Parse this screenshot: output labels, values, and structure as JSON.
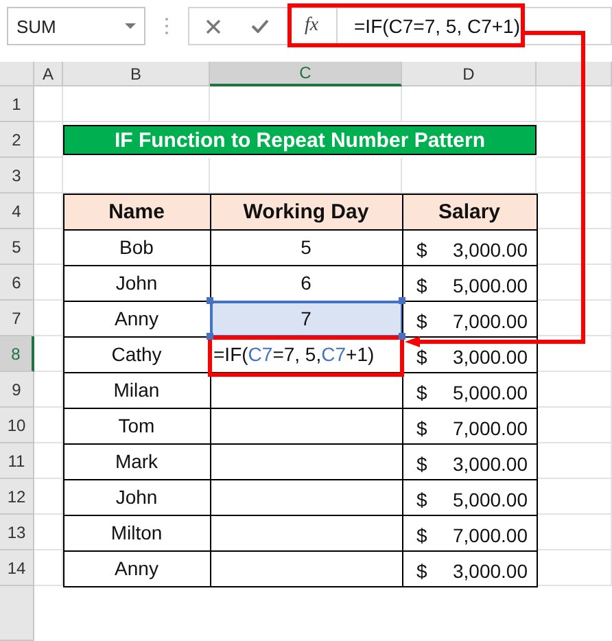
{
  "formula_bar": {
    "name_box": "SUM",
    "fx": "fx",
    "formula": "=IF(C7=7, 5, C7+1)"
  },
  "column_headers": [
    {
      "label": "A",
      "selected": false
    },
    {
      "label": "B",
      "selected": false
    },
    {
      "label": "C",
      "selected": true
    },
    {
      "label": "D",
      "selected": false
    }
  ],
  "row_headers": [
    {
      "label": "1",
      "selected": false
    },
    {
      "label": "2",
      "selected": false
    },
    {
      "label": "3",
      "selected": false
    },
    {
      "label": "4",
      "selected": false
    },
    {
      "label": "5",
      "selected": false
    },
    {
      "label": "6",
      "selected": false
    },
    {
      "label": "7",
      "selected": false
    },
    {
      "label": "8",
      "selected": true
    },
    {
      "label": "9",
      "selected": false
    },
    {
      "label": "10",
      "selected": false
    },
    {
      "label": "11",
      "selected": false
    },
    {
      "label": "12",
      "selected": false
    },
    {
      "label": "13",
      "selected": false
    },
    {
      "label": "14",
      "selected": false
    }
  ],
  "title": "IF Function to Repeat Number Pattern",
  "table": {
    "columns": [
      "Name",
      "Working Day",
      "Salary"
    ],
    "rows": [
      {
        "name": "Bob",
        "working_day": "5",
        "currency": "$",
        "salary": "3,000.00",
        "referenced": false,
        "editing": false
      },
      {
        "name": "John",
        "working_day": "6",
        "currency": "$",
        "salary": "5,000.00",
        "referenced": false,
        "editing": false
      },
      {
        "name": "Anny",
        "working_day": "7",
        "currency": "$",
        "salary": "7,000.00",
        "referenced": true,
        "editing": false
      },
      {
        "name": "Cathy",
        "formula_parts": [
          {
            "text": "=IF(",
            "ref": false
          },
          {
            "text": "C7",
            "ref": true
          },
          {
            "text": "=7, 5, ",
            "ref": false
          },
          {
            "text": "C7",
            "ref": true
          },
          {
            "text": "+1)",
            "ref": false
          }
        ],
        "currency": "$",
        "salary": "3,000.00",
        "referenced": false,
        "editing": true
      },
      {
        "name": "Milan",
        "currency": "$",
        "salary": "5,000.00",
        "referenced": false,
        "editing": false
      },
      {
        "name": "Tom",
        "currency": "$",
        "salary": "7,000.00",
        "referenced": false,
        "editing": false
      },
      {
        "name": "Mark",
        "currency": "$",
        "salary": "3,000.00",
        "referenced": false,
        "editing": false
      },
      {
        "name": "John",
        "currency": "$",
        "salary": "5,000.00",
        "referenced": false,
        "editing": false
      },
      {
        "name": "Milton",
        "currency": "$",
        "salary": "7,000.00",
        "referenced": false,
        "editing": false
      },
      {
        "name": "Anny",
        "currency": "$",
        "salary": "3,000.00",
        "referenced": false,
        "editing": false
      }
    ]
  }
}
